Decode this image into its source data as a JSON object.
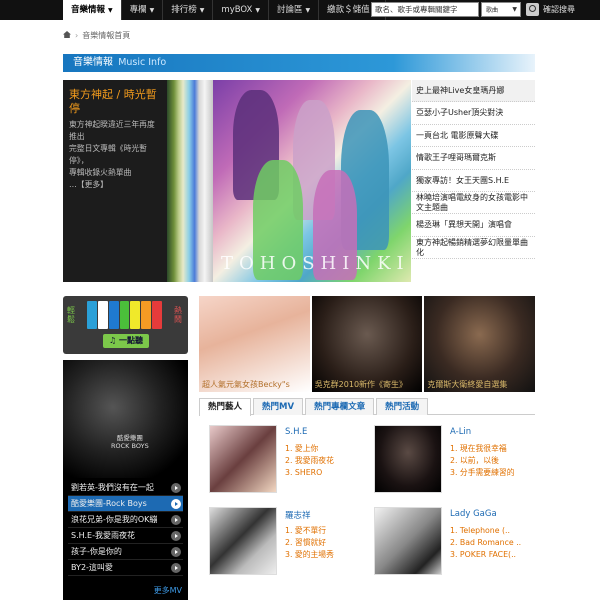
{
  "nav": {
    "items": [
      {
        "label": "音樂情報",
        "active": true
      },
      {
        "label": "專欄"
      },
      {
        "label": "排行榜"
      },
      {
        "label": "myBOX"
      },
      {
        "label": "討論區"
      },
      {
        "label": "繳款＄儲值"
      }
    ],
    "search_placeholder": "歌名、歌手或專輯關鍵字",
    "search_category": "歌曲",
    "search_button": "確認搜尋"
  },
  "breadcrumb": {
    "label": "音樂情報首頁"
  },
  "section": {
    "title": "音樂情報",
    "title_en": "Music Info"
  },
  "feature": {
    "title": "東方神起 / 時光暫停",
    "desc_1": "東方神起睽違近三年再度推出",
    "desc_2": "完整日文專輯《時光暫停》，",
    "desc_3": "專輯收錄火熱單曲",
    "desc_4": "…【更多】",
    "watermark": "TOHOSHINKI"
  },
  "news": [
    "史上最神Live女皇瑪丹娜",
    "亞瑟小子Usher頂尖對決",
    "一頁台北 電影原聲大碟",
    "情歌王子哩哥瑪爾克斯",
    "獨家專訪！女王天團S.H.E",
    "林曉培演唱電紋身的女孩電影中文主題曲",
    "楊丞琳「異想天開」演唱會",
    "東方神起暢銷精選夢幻限量單曲化"
  ],
  "player": {
    "left_label": "輕鬆",
    "right_label": "熱鬧",
    "button": "一點聽"
  },
  "artists": [
    {
      "caption": "超人氣元氣女孩Becky\"s"
    },
    {
      "caption": "吳克群2010新作《寄生》"
    },
    {
      "caption": "克爾斯大衛終愛自選集"
    }
  ],
  "mv": {
    "logo_line1": "酷愛樂團",
    "logo_line2": "ROCK BOYS",
    "items": [
      {
        "label": "劉若英-我們沒有在一起"
      },
      {
        "label": "酷愛樂團-Rock Boys",
        "active": true
      },
      {
        "label": "浪花兄弟-你是我的OK繃"
      },
      {
        "label": "S.H.E-我愛雨夜花"
      },
      {
        "label": "孩子-你是你的"
      },
      {
        "label": "BY2-這叫愛"
      }
    ],
    "more": "更多MV"
  },
  "tabs": [
    {
      "label": "熱門藝人",
      "active": true
    },
    {
      "label": "熱門MV"
    },
    {
      "label": "熱門專欄文章"
    },
    {
      "label": "熱門活動"
    }
  ],
  "hot_artists": [
    {
      "name": "S.H.E",
      "songs": [
        "愛上你",
        "我愛雨夜花",
        "SHERO"
      ]
    },
    {
      "name": "A-Lin",
      "songs": [
        "現在我很幸福",
        "以前，以後",
        "分手需要練習的"
      ]
    },
    {
      "name": "羅志祥",
      "songs": [
        "愛不單行",
        "習慣就好",
        "愛的主場秀"
      ]
    },
    {
      "name": "Lady GaGa",
      "songs": [
        "Telephone (..",
        "Bad Romance ..",
        "POKER FACE(.."
      ]
    }
  ],
  "colors": {
    "accent": "#1d6ab3",
    "feature_title": "#f29b1c",
    "rank": "#e07000"
  }
}
